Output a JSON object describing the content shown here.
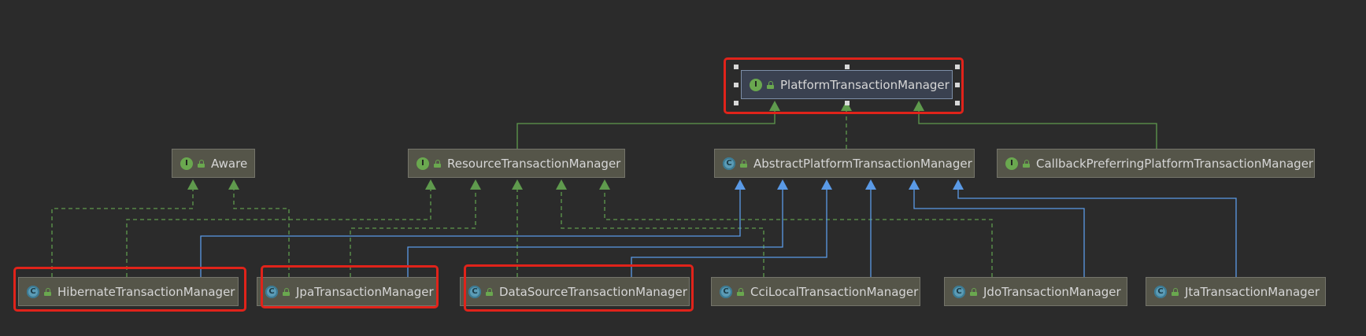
{
  "nodes": [
    {
      "id": "platform",
      "label": "PlatformTransactionManager",
      "kind": "interface"
    },
    {
      "id": "aware",
      "label": "Aware",
      "kind": "interface"
    },
    {
      "id": "resource",
      "label": "ResourceTransactionManager",
      "kind": "interface"
    },
    {
      "id": "abstract",
      "label": "AbstractPlatformTransactionManager",
      "kind": "class"
    },
    {
      "id": "callback",
      "label": "CallbackPreferringPlatformTransactionManager",
      "kind": "interface"
    },
    {
      "id": "hibernate",
      "label": "HibernateTransactionManager",
      "kind": "class"
    },
    {
      "id": "jpa",
      "label": "JpaTransactionManager",
      "kind": "class"
    },
    {
      "id": "datasource",
      "label": "DataSourceTransactionManager",
      "kind": "class"
    },
    {
      "id": "cci",
      "label": "CciLocalTransactionManager",
      "kind": "class"
    },
    {
      "id": "jdo",
      "label": "JdoTransactionManager",
      "kind": "class"
    },
    {
      "id": "jta",
      "label": "JtaTransactionManager",
      "kind": "class"
    }
  ],
  "icons": {
    "interface": {
      "letter": "I",
      "name": "interface-icon"
    },
    "class": {
      "letter": "C",
      "name": "class-icon"
    },
    "access": {
      "name": "lock-icon"
    }
  },
  "edges": [
    {
      "from": "resource",
      "to": "platform",
      "style": "extends"
    },
    {
      "from": "abstract",
      "to": "platform",
      "style": "implements"
    },
    {
      "from": "callback",
      "to": "platform",
      "style": "extends"
    },
    {
      "from": "hibernate",
      "to": "aware",
      "style": "implements"
    },
    {
      "from": "jpa",
      "to": "aware",
      "style": "implements"
    },
    {
      "from": "hibernate",
      "to": "resource",
      "style": "implements"
    },
    {
      "from": "jpa",
      "to": "resource",
      "style": "implements"
    },
    {
      "from": "datasource",
      "to": "resource",
      "style": "implements"
    },
    {
      "from": "cci",
      "to": "resource",
      "style": "implements"
    },
    {
      "from": "jdo",
      "to": "resource",
      "style": "implements"
    },
    {
      "from": "hibernate",
      "to": "abstract",
      "style": "inherits"
    },
    {
      "from": "jpa",
      "to": "abstract",
      "style": "inherits"
    },
    {
      "from": "datasource",
      "to": "abstract",
      "style": "inherits"
    },
    {
      "from": "cci",
      "to": "abstract",
      "style": "inherits"
    },
    {
      "from": "jdo",
      "to": "abstract",
      "style": "inherits"
    },
    {
      "from": "jta",
      "to": "abstract",
      "style": "inherits"
    }
  ],
  "highlighted": [
    "platform",
    "hibernate",
    "jpa",
    "datasource"
  ],
  "selected": "platform",
  "colors": {
    "background": "#2b2b2b",
    "node_fill": "#555549",
    "node_border": "#74746a",
    "text": "#d6d6d6",
    "green_edge": "#5f9a4d",
    "blue_edge": "#5a9ae6",
    "highlight": "#e0231a"
  }
}
